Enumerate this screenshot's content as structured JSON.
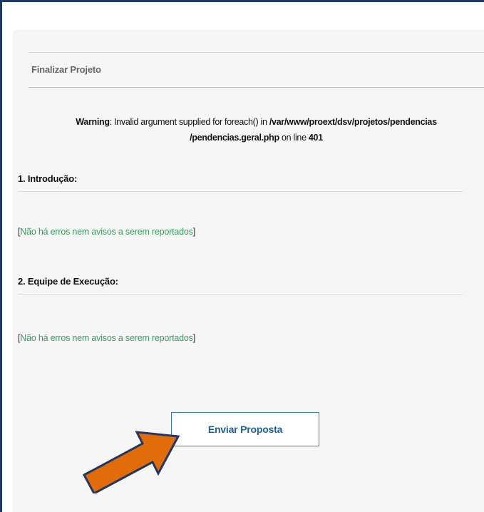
{
  "header": {
    "title": "Finalizar Projeto"
  },
  "warning": {
    "label": "Warning",
    "text_prefix": ": Invalid argument supplied for foreach() in ",
    "path_part1": "/var/www/proext/dsv/projetos/pendencias",
    "path_part2": "/pendencias.geral.php",
    "text_mid": " on line ",
    "line_number": "401"
  },
  "sections": [
    {
      "title": "1. Introdução:",
      "message_open": "[",
      "message": "Não há erros nem avisos a serem reportados",
      "message_close": "]"
    },
    {
      "title": "2. Equipe de Execução:",
      "message_open": "[",
      "message": "Não há erros nem avisos a serem reportados",
      "message_close": "]"
    }
  ],
  "actions": {
    "submit_label": "Enviar Proposta"
  },
  "colors": {
    "frame_border": "#1f3864",
    "success_text": "#3a9b5c",
    "button_border": "#2f7fb8",
    "button_text": "#1f5f99",
    "arrow_fill": "#e36c0a",
    "arrow_stroke": "#1f3864"
  },
  "annotations": {
    "pointer": "arrow-icon"
  }
}
